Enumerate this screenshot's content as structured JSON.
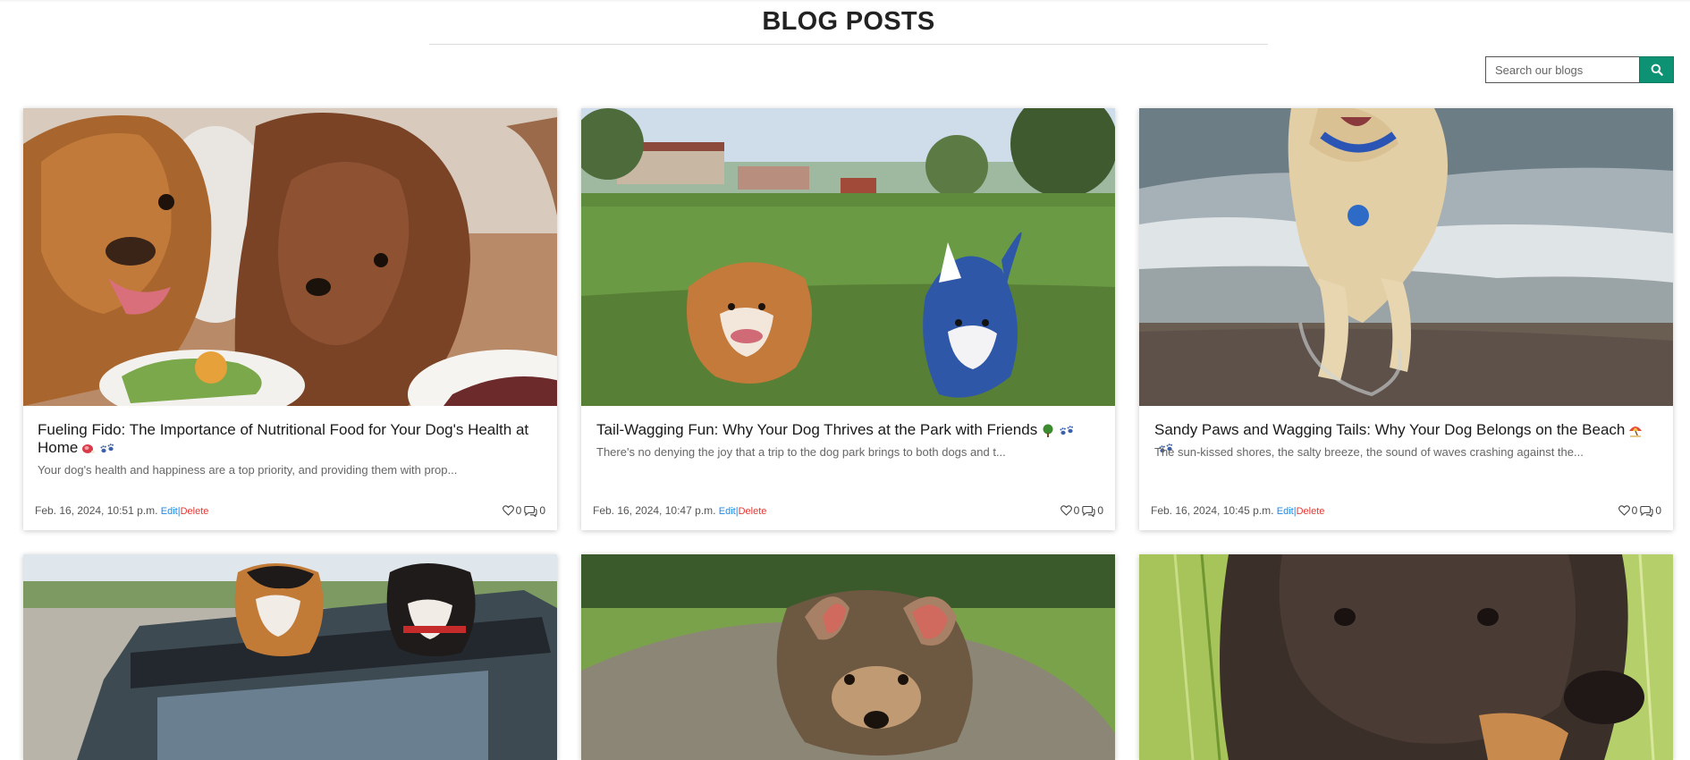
{
  "page": {
    "title": "BLOG POSTS"
  },
  "search": {
    "placeholder": "Search our blogs",
    "value": "",
    "button_icon": "search-icon"
  },
  "colors": {
    "accent": "#0e9274",
    "edit_link": "#1e88e5",
    "delete_link": "#e53935"
  },
  "posts": [
    {
      "title": "Fueling Fido: The Importance of Nutritional Food for Your Dog's Health at Home",
      "emojis": [
        "meat-icon",
        "paw-prints-icon"
      ],
      "excerpt": "Your dog's health and happiness are a top priority, and providing them with prop...",
      "date": "Feb. 16, 2024, 10:51 p.m.",
      "edit_label": "Edit",
      "separator": "|",
      "delete_label": "Delete",
      "likes": "0",
      "comments": "0",
      "image": "two-dogs-eating-from-bowls-image"
    },
    {
      "title": "Tail-Wagging Fun: Why Your Dog Thrives at the Park with Friends",
      "emojis": [
        "tree-icon",
        "paw-prints-icon"
      ],
      "excerpt": "There's no denying the joy that a trip to the dog park brings to both dogs and t...",
      "date": "Feb. 16, 2024, 10:47 p.m.",
      "edit_label": "Edit",
      "separator": "|",
      "delete_label": "Delete",
      "likes": "0",
      "comments": "0",
      "image": "two-dogs-running-in-park-image"
    },
    {
      "title": "Sandy Paws and Wagging Tails: Why Your Dog Belongs on the Beach",
      "emojis": [
        "beach-umbrella-icon",
        "paw-prints-icon"
      ],
      "excerpt": "The sun-kissed shores, the salty breeze, the sound of waves crashing against the...",
      "date": "Feb. 16, 2024, 10:45 p.m.",
      "edit_label": "Edit",
      "separator": "|",
      "delete_label": "Delete",
      "likes": "0",
      "comments": "0",
      "image": "dog-running-on-beach-image"
    },
    {
      "image": "dogs-in-convertible-car-image"
    },
    {
      "image": "puppy-lying-on-grass-image"
    },
    {
      "image": "dark-dog-closeup-image"
    }
  ]
}
